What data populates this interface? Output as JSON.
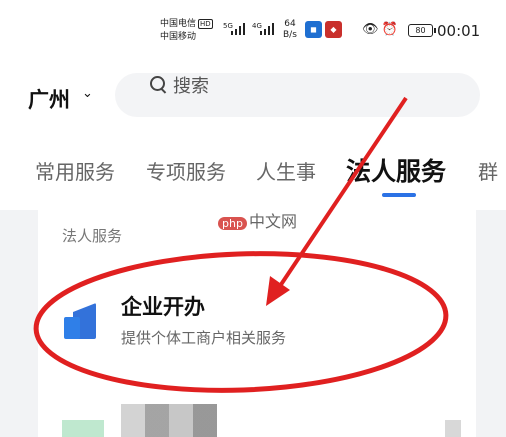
{
  "status_bar": {
    "carrier1": "中国电信",
    "carrier1_badge": "HD",
    "carrier2": "中国移动",
    "net1": "5G",
    "net2": "4G",
    "speed_value": "64",
    "speed_unit": "B/s",
    "battery": "80",
    "time": "00:01"
  },
  "header": {
    "city": "广州",
    "search_placeholder": "搜索"
  },
  "tabs": [
    {
      "label": "常用服务"
    },
    {
      "label": "专项服务"
    },
    {
      "label": "人生事"
    },
    {
      "label": "法人服务"
    },
    {
      "label": "群"
    }
  ],
  "active_tab": "法人服务",
  "section": {
    "title": "法人服务",
    "item": {
      "title": "企业开办",
      "subtitle": "提供个体工商户相关服务"
    }
  },
  "watermark": {
    "badge": "php",
    "text": "中文网"
  },
  "colors": {
    "accent": "#2b72e5",
    "annotation": "#e02020"
  }
}
